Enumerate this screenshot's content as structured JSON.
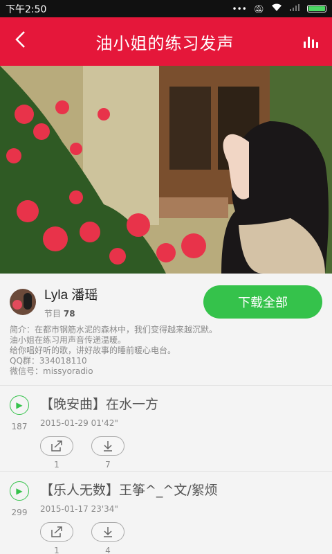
{
  "status": {
    "time": "下午2:50",
    "signal_text": "..."
  },
  "header": {
    "title": "油小姐的练习发声"
  },
  "profile": {
    "name": "Lyla 潘瑶",
    "count_label": "节目",
    "count_value": "78",
    "download_label": "下载全部"
  },
  "intro": [
    "简介：在都市钢筋水泥的森林中，我们变得越来越沉默。",
    "油小姐在练习用声音传递温暖。",
    "给你唱好听的歌，讲好故事的睡前暖心电台。",
    "QQ群：334018110",
    "微信号：missyoradio"
  ],
  "episodes": [
    {
      "title": "【晚安曲】在水一方",
      "date": "2015-01-29",
      "duration": "01'42\"",
      "plays": "187",
      "shares": "1",
      "downloads": "7"
    },
    {
      "title": "【乐人无数】王筝^_^文/絮烦",
      "date": "2015-01-17",
      "duration": "23'34\"",
      "plays": "299",
      "shares": "1",
      "downloads": "4"
    }
  ],
  "colors": {
    "accent_red": "#e5173a",
    "accent_green": "#35c24b"
  },
  "icons": [
    "back-arrow-icon",
    "equalizer-icon",
    "play-icon",
    "share-icon",
    "download-icon"
  ]
}
